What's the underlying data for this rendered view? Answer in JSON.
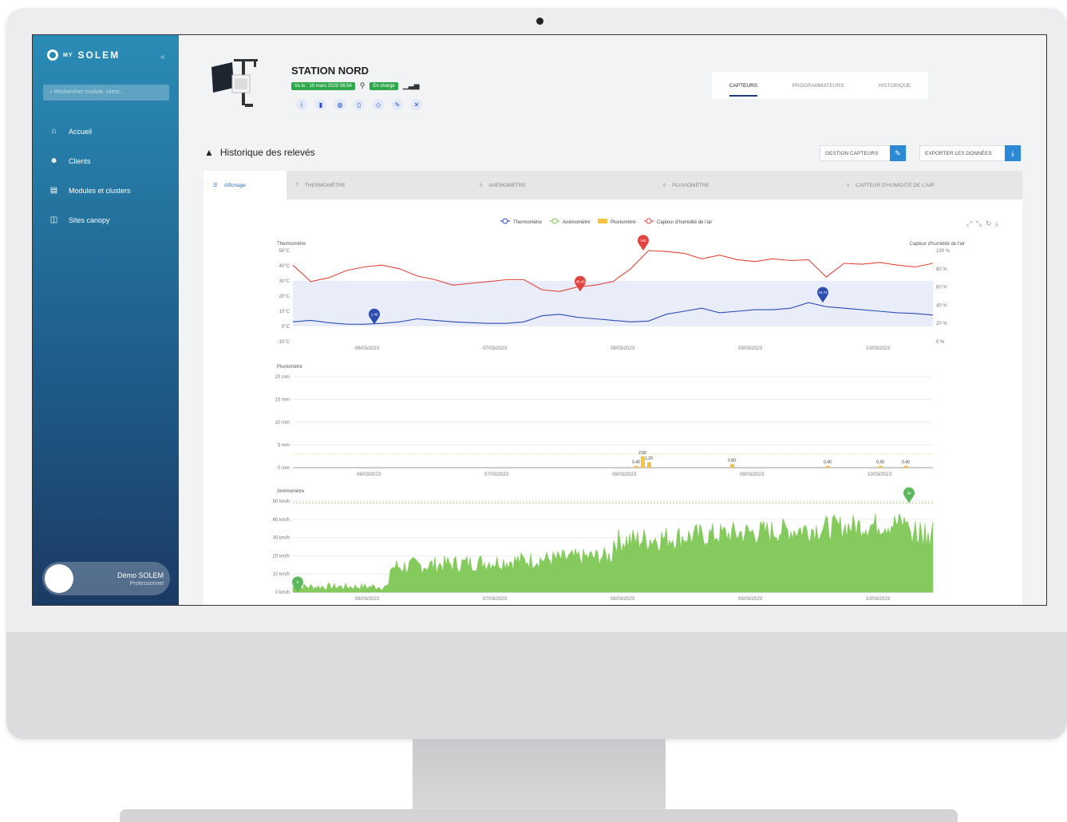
{
  "brand": {
    "name": "SOLEM",
    "prefix": "MY"
  },
  "sidebar": {
    "search_placeholder": "Rechercher module, client...",
    "items": [
      {
        "label": "Accueil",
        "icon": "home-icon"
      },
      {
        "label": "Clients",
        "icon": "users-icon"
      },
      {
        "label": "Modules et clusters",
        "icon": "modules-icon"
      },
      {
        "label": "Sites canopy",
        "icon": "sites-icon"
      }
    ],
    "user": {
      "name": "Démo SOLEM",
      "role": "Professionnel"
    }
  },
  "header": {
    "title": "STATION NORD",
    "seen_badge": "Vu le : 10 mars 2023 08:54",
    "status_badge": "En charge",
    "tabs": [
      "CAPTEURS",
      "PROGRAMMATEURS",
      "HISTORIQUE"
    ],
    "active_tab": "CAPTEURS"
  },
  "section": {
    "title": "Historique des relevés",
    "manage_label": "GESTION CAPTEURS",
    "export_label": "EXPORTER LES DONNÉES"
  },
  "panel_tabs": [
    "Affichage",
    "THERMOMÈTRE",
    "ANÉMOMÈTRE",
    "PLUVIOMÈTRE",
    "CAPTEUR D'HUMIDITÉ DE L'AIR"
  ],
  "colors": {
    "thermo": "#2d4cb0",
    "anemo": "#7ec855",
    "pluvio": "#f5c242",
    "humid": "#e0463e",
    "accent": "#2b8ad6",
    "sidebar": "#1f5f8d"
  },
  "chart_data": [
    {
      "type": "line",
      "legend": [
        "Thermomètre",
        "Anémomètre",
        "Pluviomètre",
        "Capteur d'humidité de l'air"
      ],
      "ylabel": "Thermomètre",
      "ylabel_right": "Capteur d'humidité de l'air",
      "y_ticks": [
        "50°C",
        "40°C",
        "30°C",
        "20°C",
        "10°C",
        "0°C",
        "-10°C"
      ],
      "y_right_ticks": [
        "100 %",
        "80 %",
        "60 %",
        "40 %",
        "20 %",
        "0 %"
      ],
      "x_ticks": [
        "06/03/2023",
        "07/03/2023",
        "08/03/2023",
        "09/03/2023",
        "10/03/2023"
      ],
      "ylim": [
        -10,
        50
      ],
      "series": [
        {
          "name": "Thermomètre",
          "values": [
            3,
            4,
            2.5,
            1.5,
            1.4,
            2,
            3,
            5,
            4,
            3,
            2.5,
            2,
            2,
            3,
            7,
            8,
            6,
            5,
            4,
            3,
            3.5,
            8,
            10,
            12,
            9,
            10,
            11,
            11,
            12,
            15.7,
            13,
            12,
            11,
            10,
            9,
            8.5,
            7.5
          ]
        },
        {
          "name": "Capteur d'humidité de l'air",
          "values": [
            84,
            66,
            70,
            78,
            82,
            84,
            80,
            72,
            68,
            62,
            64,
            66,
            68,
            68,
            57,
            55,
            60,
            62,
            66,
            80,
            100,
            99,
            97,
            91,
            95,
            90,
            88,
            91,
            89,
            90,
            71,
            86,
            85,
            87,
            84,
            82,
            86
          ]
        }
      ],
      "markers": [
        "1.46",
        "45.40",
        "100",
        "15.72"
      ]
    },
    {
      "type": "bar",
      "ylabel": "Pluviomètre",
      "y_ticks": [
        "20 mm",
        "15 mm",
        "10 mm",
        "5 mm",
        "0 mm"
      ],
      "x_ticks": [
        "06/03/2023",
        "07/03/2023",
        "08/03/2023",
        "09/03/2023",
        "10/03/2023"
      ],
      "ylim": [
        0,
        20
      ],
      "labels": [
        "0.40",
        "2.50",
        "1.20",
        "0.80",
        "0.40",
        "0.40",
        "0.40"
      ],
      "values": [
        0.4,
        2.5,
        1.2,
        0.8,
        0.4,
        0.4,
        0.4
      ]
    },
    {
      "type": "area",
      "ylabel": "Anémomètre",
      "y_ticks": [
        "50 km/h",
        "40 km/h",
        "30 km/h",
        "20 km/h",
        "10 km/h",
        "0 km/h"
      ],
      "x_ticks": [
        "06/03/2023",
        "07/03/2023",
        "08/03/2023",
        "09/03/2023",
        "10/03/2023"
      ],
      "ylim": [
        0,
        50
      ],
      "markers": [
        "0",
        "49"
      ]
    }
  ]
}
